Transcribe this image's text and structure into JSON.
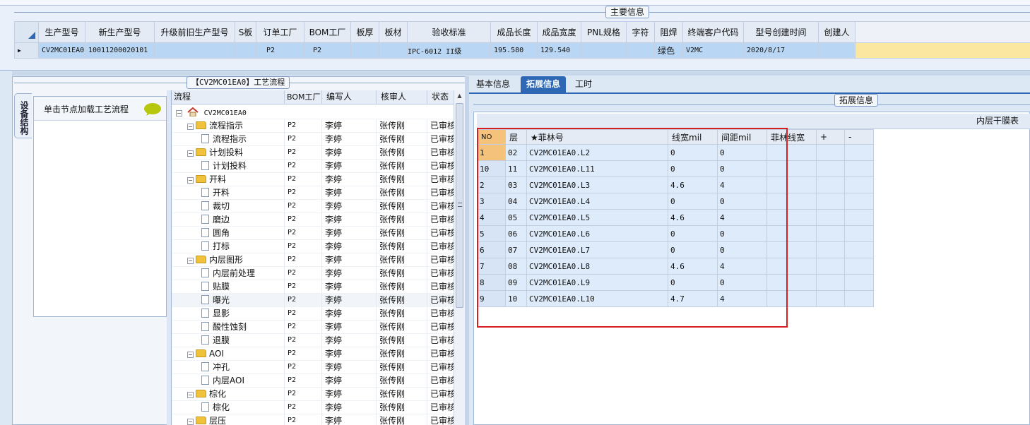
{
  "main_info": {
    "section_title": "主要信息",
    "columns": [
      "生产型号",
      "新生产型号",
      "升级前旧生产型号",
      "S板",
      "订单工厂",
      "BOM工厂",
      "板厚",
      "板材",
      "验收标准",
      "成品长度",
      "成品宽度",
      "PNL规格",
      "字符",
      "阻焊",
      "终端客户代码",
      "型号创建时间",
      "创建人"
    ],
    "row": [
      "CV2MC01EA0",
      "10011200020101",
      "",
      "",
      "P2",
      "P2",
      "",
      "",
      "IPC-6012 II级",
      "195.580",
      "129.540",
      "",
      "",
      "绿色",
      "V2MC",
      "2020/8/17",
      ""
    ]
  },
  "process": {
    "section_title": "【CV2MC01EA0】工艺流程",
    "side_tab": "设备结构",
    "node_hint": "单击节点加载工艺流程",
    "columns": [
      "流程",
      "BOM工厂",
      "编写人",
      "核审人",
      "状态"
    ],
    "root": "CV2MC01EA0",
    "rows": [
      {
        "name": "流程指示",
        "type": "folder",
        "bom": "P2",
        "writer": "李婷",
        "reviewer": "张传刚",
        "status": "已审核"
      },
      {
        "name": "流程指示",
        "type": "doc",
        "bom": "P2",
        "writer": "李婷",
        "reviewer": "张传刚",
        "status": "已审核"
      },
      {
        "name": "计划投料",
        "type": "folder",
        "bom": "P2",
        "writer": "李婷",
        "reviewer": "张传刚",
        "status": "已审核"
      },
      {
        "name": "计划投料",
        "type": "doc",
        "bom": "P2",
        "writer": "李婷",
        "reviewer": "张传刚",
        "status": "已审核"
      },
      {
        "name": "开料",
        "type": "folder",
        "bom": "P2",
        "writer": "李婷",
        "reviewer": "张传刚",
        "status": "已审核"
      },
      {
        "name": "开料",
        "type": "doc",
        "bom": "P2",
        "writer": "李婷",
        "reviewer": "张传刚",
        "status": "已审核"
      },
      {
        "name": "裁切",
        "type": "doc",
        "bom": "P2",
        "writer": "李婷",
        "reviewer": "张传刚",
        "status": "已审核"
      },
      {
        "name": "磨边",
        "type": "doc",
        "bom": "P2",
        "writer": "李婷",
        "reviewer": "张传刚",
        "status": "已审核"
      },
      {
        "name": "圆角",
        "type": "doc",
        "bom": "P2",
        "writer": "李婷",
        "reviewer": "张传刚",
        "status": "已审核"
      },
      {
        "name": "打标",
        "type": "doc",
        "bom": "P2",
        "writer": "李婷",
        "reviewer": "张传刚",
        "status": "已审核"
      },
      {
        "name": "内层图形",
        "type": "folder",
        "bom": "P2",
        "writer": "李婷",
        "reviewer": "张传刚",
        "status": "已审核"
      },
      {
        "name": "内层前处理",
        "type": "doc",
        "bom": "P2",
        "writer": "李婷",
        "reviewer": "张传刚",
        "status": "已审核"
      },
      {
        "name": "贴膜",
        "type": "doc",
        "bom": "P2",
        "writer": "李婷",
        "reviewer": "张传刚",
        "status": "已审核"
      },
      {
        "name": "曝光",
        "type": "doc",
        "bom": "P2",
        "writer": "李婷",
        "reviewer": "张传刚",
        "status": "已审核"
      },
      {
        "name": "显影",
        "type": "doc",
        "bom": "P2",
        "writer": "李婷",
        "reviewer": "张传刚",
        "status": "已审核"
      },
      {
        "name": "酸性蚀刻",
        "type": "doc",
        "bom": "P2",
        "writer": "李婷",
        "reviewer": "张传刚",
        "status": "已审核"
      },
      {
        "name": "退膜",
        "type": "doc",
        "bom": "P2",
        "writer": "李婷",
        "reviewer": "张传刚",
        "status": "已审核"
      },
      {
        "name": "AOI",
        "type": "folder",
        "bom": "P2",
        "writer": "李婷",
        "reviewer": "张传刚",
        "status": "已审核"
      },
      {
        "name": "冲孔",
        "type": "doc",
        "bom": "P2",
        "writer": "李婷",
        "reviewer": "张传刚",
        "status": "已审核"
      },
      {
        "name": "内层AOI",
        "type": "doc",
        "bom": "P2",
        "writer": "李婷",
        "reviewer": "张传刚",
        "status": "已审核"
      },
      {
        "name": "棕化",
        "type": "folder",
        "bom": "P2",
        "writer": "李婷",
        "reviewer": "张传刚",
        "status": "已审核"
      },
      {
        "name": "棕化",
        "type": "doc",
        "bom": "P2",
        "writer": "李婷",
        "reviewer": "张传刚",
        "status": "已审核"
      },
      {
        "name": "层压",
        "type": "folder",
        "bom": "P2",
        "writer": "李婷",
        "reviewer": "张传刚",
        "status": "已审核"
      }
    ]
  },
  "right": {
    "tabs": [
      "基本信息",
      "拓展信息",
      "工时"
    ],
    "active_tab": 1,
    "section_title": "拓展信息",
    "table_title": "内层干膜表",
    "columns": [
      "NO",
      "层",
      "★菲林号",
      "线宽mil",
      "间距mil",
      "菲林线宽",
      "+",
      "-"
    ],
    "rows": [
      [
        "1",
        "02",
        "CV2MC01EA0.L2",
        "0",
        "0"
      ],
      [
        "10",
        "11",
        "CV2MC01EA0.L11",
        "0",
        "0"
      ],
      [
        "2",
        "03",
        "CV2MC01EA0.L3",
        "4.6",
        "4"
      ],
      [
        "3",
        "04",
        "CV2MC01EA0.L4",
        "0",
        "0"
      ],
      [
        "4",
        "05",
        "CV2MC01EA0.L5",
        "4.6",
        "4"
      ],
      [
        "5",
        "06",
        "CV2MC01EA0.L6",
        "0",
        "0"
      ],
      [
        "6",
        "07",
        "CV2MC01EA0.L7",
        "0",
        "0"
      ],
      [
        "7",
        "08",
        "CV2MC01EA0.L8",
        "4.6",
        "4"
      ],
      [
        "8",
        "09",
        "CV2MC01EA0.L9",
        "0",
        "0"
      ],
      [
        "9",
        "10",
        "CV2MC01EA0.L10",
        "4.7",
        "4"
      ]
    ]
  },
  "colors": {
    "accent": "#2e68b4",
    "selection": "#b9d7f4",
    "highlight": "#d62020",
    "row_band": "#fce7a0"
  }
}
